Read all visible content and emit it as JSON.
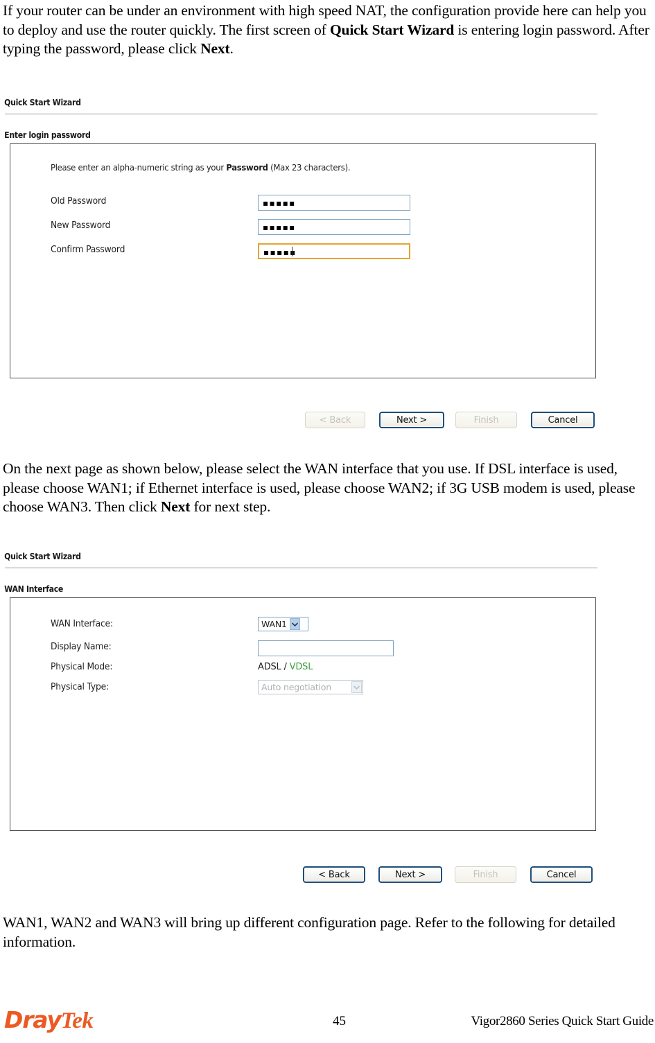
{
  "paragraphs": {
    "intro_1": "If your router can be under an environment with high speed NAT, the configuration provide here can help you to deploy and use the router quickly. The first screen of ",
    "intro_1_bold": "Quick Start Wizard",
    "intro_1_cont": " is entering login password. After typing the password, please click ",
    "intro_1_bold2": "Next",
    "intro_1_end": ".",
    "intro_2": "On the next page as shown below, please select the WAN interface that you use. If DSL interface is used, please choose WAN1; if Ethernet interface is used, please choose WAN2; if 3G USB modem is used, please choose WAN3. Then click ",
    "intro_2_bold": "Next",
    "intro_2_end": " for next step.",
    "outro": "WAN1, WAN2 and WAN3 will bring up different configuration page. Refer to the following for detailed information."
  },
  "figure_password": {
    "title": "Quick Start Wizard",
    "section_label": "Enter login password",
    "note_prefix": "Please enter an alpha-numeric string as your ",
    "note_bold": "Password",
    "note_suffix": " (Max 23 characters).",
    "fields": [
      {
        "label": "Old Password",
        "value": "▪▪▪▪▪",
        "state": "normal"
      },
      {
        "label": "New Password",
        "value": "▪▪▪▪▪",
        "state": "normal"
      },
      {
        "label": "Confirm Password",
        "value": "▪▪▪▪▪",
        "state": "focused"
      }
    ],
    "buttons": [
      {
        "label": "< Back",
        "state": "disabled"
      },
      {
        "label": "Next >",
        "state": "enabled"
      },
      {
        "label": "Finish",
        "state": "disabled"
      },
      {
        "label": "Cancel",
        "state": "enabled"
      }
    ]
  },
  "figure_wan": {
    "title": "Quick Start Wizard",
    "section_label": "WAN Interface",
    "rows": [
      {
        "label": "WAN Interface:",
        "type": "select",
        "value": "WAN1",
        "state": "enabled"
      },
      {
        "label": "Display Name:",
        "type": "text",
        "value": "",
        "state": "normal"
      },
      {
        "label": "Physical Mode:",
        "type": "static",
        "value": "ADSL / ",
        "accent": "VDSL"
      },
      {
        "label": "Physical Type:",
        "type": "select",
        "value": "Auto negotiation",
        "state": "disabled"
      }
    ],
    "buttons": [
      {
        "label": "< Back",
        "state": "enabled"
      },
      {
        "label": "Next >",
        "state": "enabled"
      },
      {
        "label": "Finish",
        "state": "disabled"
      },
      {
        "label": "Cancel",
        "state": "enabled"
      }
    ]
  },
  "footer": {
    "logo_part1": "Dray",
    "logo_part2": "Tek",
    "page_number": "45",
    "guide_title": "Vigor2860 Series Quick Start Guide"
  },
  "colors": {
    "brand": "#ec5a22",
    "accent_green": "#3c9e3c",
    "focus_border": "#e3a533",
    "field_border": "#7da2c0",
    "button_border": "#1f4e79"
  }
}
